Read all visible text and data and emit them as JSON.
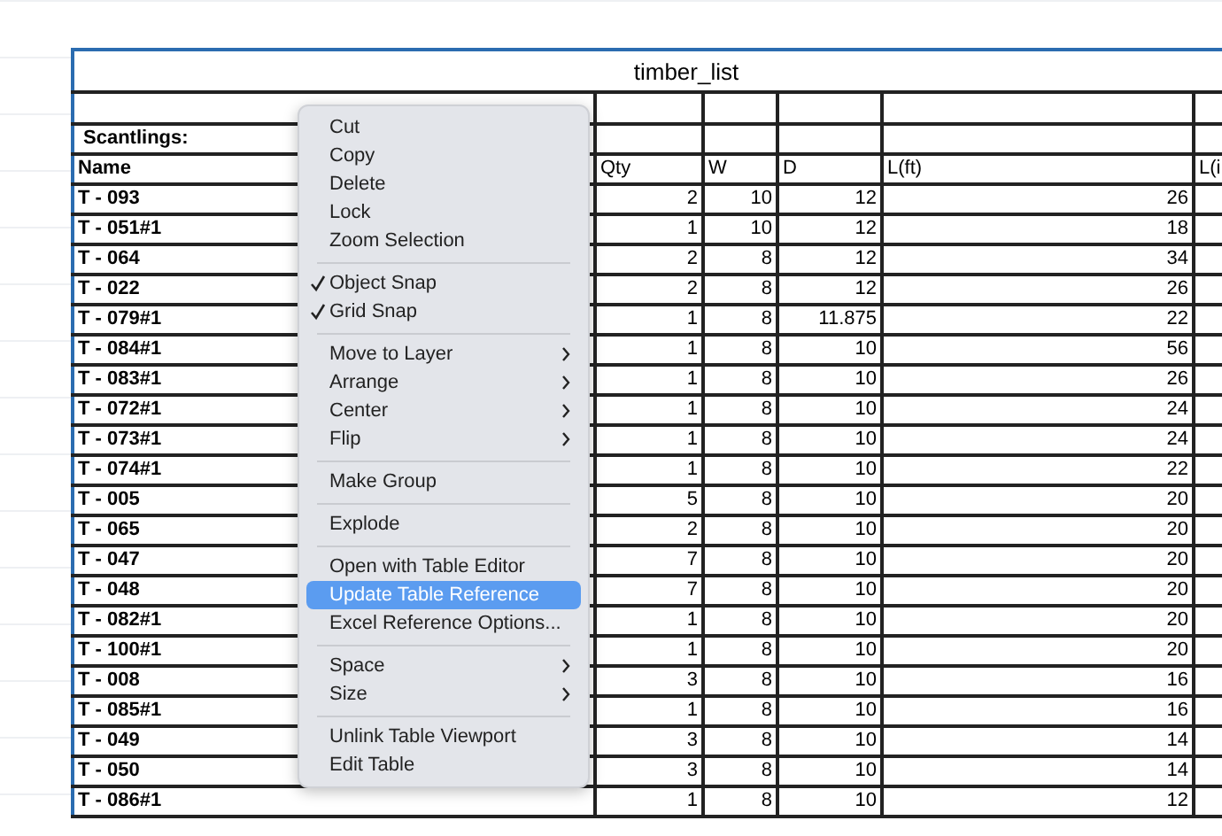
{
  "table": {
    "title": "timber_list",
    "section_label": "Scantlings:",
    "columns": [
      "Name",
      "Qty",
      "W",
      "D",
      "L(ft)",
      "L(i"
    ],
    "rows": [
      [
        "T - 093",
        "2",
        "10",
        "12",
        "26"
      ],
      [
        "T - 051#1",
        "1",
        "10",
        "12",
        "18"
      ],
      [
        "T - 064",
        "2",
        "8",
        "12",
        "34"
      ],
      [
        "T - 022",
        "2",
        "8",
        "12",
        "26"
      ],
      [
        "T - 079#1",
        "1",
        "8",
        "11.875",
        "22"
      ],
      [
        "T - 084#1",
        "1",
        "8",
        "10",
        "56"
      ],
      [
        "T - 083#1",
        "1",
        "8",
        "10",
        "26"
      ],
      [
        "T - 072#1",
        "1",
        "8",
        "10",
        "24"
      ],
      [
        "T - 073#1",
        "1",
        "8",
        "10",
        "24"
      ],
      [
        "T - 074#1",
        "1",
        "8",
        "10",
        "22"
      ],
      [
        "T - 005",
        "5",
        "8",
        "10",
        "20"
      ],
      [
        "T - 065",
        "2",
        "8",
        "10",
        "20"
      ],
      [
        "T - 047",
        "7",
        "8",
        "10",
        "20"
      ],
      [
        "T - 048",
        "7",
        "8",
        "10",
        "20"
      ],
      [
        "T - 082#1",
        "1",
        "8",
        "10",
        "20"
      ],
      [
        "T - 100#1",
        "1",
        "8",
        "10",
        "20"
      ],
      [
        "T - 008",
        "3",
        "8",
        "10",
        "16"
      ],
      [
        "T - 085#1",
        "1",
        "8",
        "10",
        "16"
      ],
      [
        "T - 049",
        "3",
        "8",
        "10",
        "14"
      ],
      [
        "T - 050",
        "3",
        "8",
        "10",
        "14"
      ],
      [
        "T - 086#1",
        "1",
        "8",
        "10",
        "12"
      ]
    ]
  },
  "context_menu": {
    "groups": [
      [
        {
          "label": "Cut",
          "checked": false,
          "submenu": false,
          "selected": false
        },
        {
          "label": "Copy",
          "checked": false,
          "submenu": false,
          "selected": false
        },
        {
          "label": "Delete",
          "checked": false,
          "submenu": false,
          "selected": false
        },
        {
          "label": "Lock",
          "checked": false,
          "submenu": false,
          "selected": false
        },
        {
          "label": "Zoom Selection",
          "checked": false,
          "submenu": false,
          "selected": false
        }
      ],
      [
        {
          "label": "Object Snap",
          "checked": true,
          "submenu": false,
          "selected": false
        },
        {
          "label": "Grid Snap",
          "checked": true,
          "submenu": false,
          "selected": false
        }
      ],
      [
        {
          "label": "Move to Layer",
          "checked": false,
          "submenu": true,
          "selected": false
        },
        {
          "label": "Arrange",
          "checked": false,
          "submenu": true,
          "selected": false
        },
        {
          "label": "Center",
          "checked": false,
          "submenu": true,
          "selected": false
        },
        {
          "label": "Flip",
          "checked": false,
          "submenu": true,
          "selected": false
        }
      ],
      [
        {
          "label": "Make Group",
          "checked": false,
          "submenu": false,
          "selected": false
        }
      ],
      [
        {
          "label": "Explode",
          "checked": false,
          "submenu": false,
          "selected": false
        }
      ],
      [
        {
          "label": "Open with Table Editor",
          "checked": false,
          "submenu": false,
          "selected": false
        },
        {
          "label": "Update Table Reference",
          "checked": false,
          "submenu": false,
          "selected": true
        },
        {
          "label": "Excel Reference Options...",
          "checked": false,
          "submenu": false,
          "selected": false
        }
      ],
      [
        {
          "label": "Space",
          "checked": false,
          "submenu": true,
          "selected": false
        },
        {
          "label": "Size",
          "checked": false,
          "submenu": true,
          "selected": false
        }
      ],
      [
        {
          "label": "Unlink Table Viewport",
          "checked": false,
          "submenu": false,
          "selected": false
        },
        {
          "label": "Edit Table",
          "checked": false,
          "submenu": false,
          "selected": false
        }
      ]
    ]
  }
}
